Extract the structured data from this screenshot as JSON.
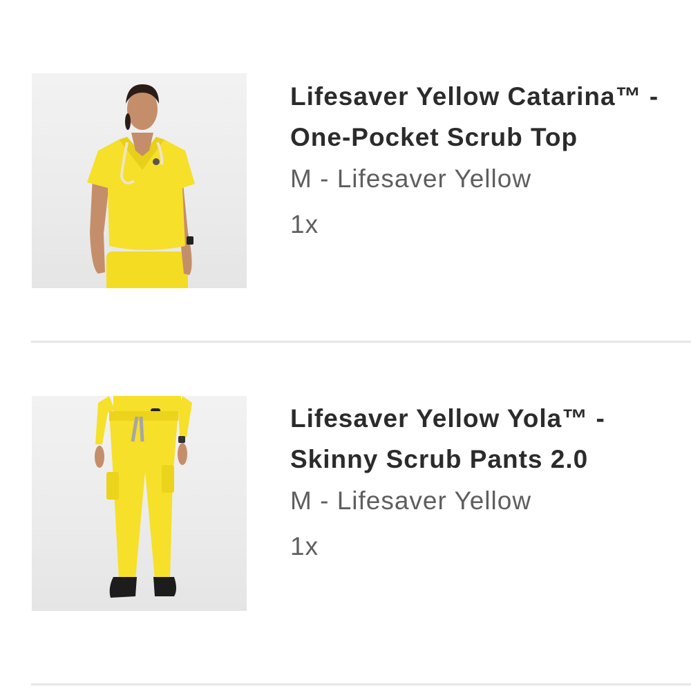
{
  "cart": {
    "items": [
      {
        "title": "Lifesaver Yellow Catarina™ - One-Pocket Scrub Top",
        "variant": "M - Lifesaver Yellow",
        "quantity": "1x",
        "image_icon": "scrub-top-photo"
      },
      {
        "title": "Lifesaver Yellow Yola™ - Skinny Scrub Pants 2.0",
        "variant": "M - Lifesaver Yellow",
        "quantity": "1x",
        "image_icon": "scrub-pants-photo"
      }
    ]
  },
  "colors": {
    "scrub_yellow": "#f6e02a",
    "title_text": "#2b2b2b",
    "secondary_text": "#5e5e5e",
    "divider": "#e6e6e6"
  }
}
